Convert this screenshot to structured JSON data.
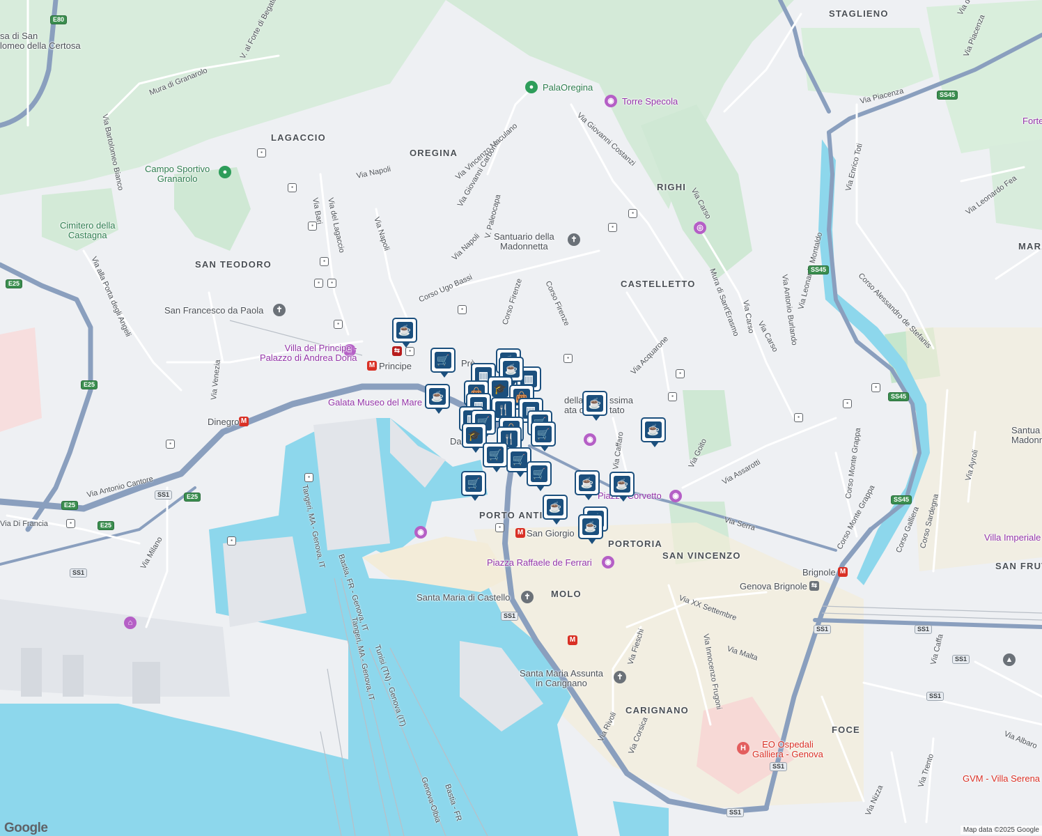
{
  "colors": {
    "water": "#8dd7ec",
    "land": "#eef0f3",
    "park": "#cdebd3",
    "highway": "#8a9fbe",
    "pin": "#1b4f7d"
  },
  "districts": [
    "LAGACCIO",
    "OREGINA",
    "RIGHI",
    "SAN TEODORO",
    "CASTELLETTO",
    "STAGLIENO",
    "PORTORIA",
    "SAN VINCENZO",
    "MOLO",
    "CARIGNANO",
    "FOCE",
    "SAN FRUT",
    "MARA",
    "PORTO ANTICO"
  ],
  "places": {
    "palaoregina": "PalaOregina",
    "torre_specola": "Torre Specola",
    "campo_sportivo": "Campo Sportivo\nGranarolo",
    "cimitero": "Cimitero della\nCastagna",
    "santuario": "Santuario della\nMadonnetta",
    "san_francesco": "San Francesco da Paola",
    "villa_principe": "Villa del Principe -\nPalazzo di Andrea Doria",
    "principe": "Principe",
    "galata": "Galata Museo del Mare",
    "dinegro": "Dinegro",
    "san_giorgio": "San Giorgio",
    "raffaele": "Piazza Raffaele de Ferrari",
    "corvetto": "Piazza Corvetto",
    "santa_maria_castello": "Santa Maria di Castello",
    "santa_maria_carignano": "Santa Maria Assunta\nin Carignano",
    "brignole_metro": "Brignole",
    "genova_brignole": "Genova Brignole",
    "galliera": "EO Ospedali\nGalliera - Genova",
    "gvm": "GVM - Villa Serena",
    "villa_imperiale": "Villa Imperiale",
    "santuario_madonna": "Santua\nMadonna de",
    "forte": "Forte",
    "certosa": "sa di San\nlomeo della Certosa",
    "annunziata": "della\nata del",
    "ssima": "ssima\ntato",
    "da": "Da",
    "pre": "Prè"
  },
  "streets": {
    "via_piacenza_1": "Via Piacenza",
    "via_piacenza_2": "Via Piacenza",
    "via_enrico_toti": "Via Enrico Toti",
    "via_leonardo_fea": "Via Leonardo Fea",
    "corso_de_stefanis": "Corso Alessandro de Stefanis",
    "via_montaldo": "Via Leonardo Montaldo",
    "via_burlando": "Via Antonio Burlando",
    "via_carso_1": "Via Carso",
    "via_carso_2": "Via Carso",
    "via_carso_3": "Via Carso",
    "mura_erasmo": "Mura di Sant'Erasmo",
    "via_costanzi": "Via Giovanni Costanzi",
    "via_maculano": "Via Vincenzo Maculano",
    "via_carbone": "Via Giovanni Carbone",
    "via_napoli_1": "Via Napoli",
    "via_napoli_2": "Via Napoli",
    "via_napoli_3": "Via Napoli",
    "v_paleocapa": "V. Paleocapa",
    "corso_bassi": "Corso Ugo Bassi",
    "corso_firenze_1": "Corso Firenze",
    "corso_firenze_2": "Corso Firenze",
    "via_acquarone": "Via Acquarone",
    "via_caffaro": "Via Caffaro",
    "via_goito": "Via Goito",
    "via_assarotti": "Via Assarotti",
    "via_serra": "Via Serra",
    "via_bari": "Via Bari",
    "via_lagaccio": "Via del Lagaccio",
    "mura_granarolo": "Mura di Granarolo",
    "v_forte_begato": "V. al Forte di Begato",
    "via_bologna_bianco": "Via Bartolomeo Bianco",
    "via_porta_angeli": "Via alla Porta degli Angeli",
    "via_venezia": "Via Venezia",
    "via_cantore": "Via Antonio Cantore",
    "via_di_francia": "Via Di Francia",
    "via_milano": "Via Milano",
    "tangeri_1": "Tangeri, MA - Genova, IT",
    "tangeri_2": "Tangeri, MA - Genova, IT",
    "bastia_1": "Bastia, FR - Genova, IT",
    "tunisi": "Tunisi (TN) - Genova (IT)",
    "genova_olbia": "Genova-Olbia",
    "bastia_2": "Bastia - FR",
    "via_xx": "Via XX Settembre",
    "via_malta": "Via Malta",
    "via_frugoni": "Via Innocenzo Frugoni",
    "via_fieschi": "Via Fieschi",
    "via_rivoli": "Via Rivoli",
    "via_corsica": "Via Corsica",
    "corso_monte_grappa_1": "Corso Monte Grappa",
    "corso_monte_grappa_2": "Corso Monte Grappa",
    "corso_galliera": "Corso Galliera",
    "corso_sardegna": "Corso Sardegna",
    "via_ayroli": "Via Ayroli",
    "via_caffa": "Via Caffa",
    "via_albaro": "Via Albaro",
    "via_trento": "Via Trento",
    "via_nizza": "Via Nizza",
    "via_de": "Via de"
  },
  "shields": [
    "E80",
    "E25",
    "E25",
    "E25",
    "E25",
    "SS1",
    "SS1",
    "SS1",
    "SS1",
    "SS1",
    "SS1",
    "SS1",
    "SS45",
    "SS45",
    "SS45",
    "SS45",
    "SS1",
    "SS1"
  ],
  "attribution": "Map data ©2025 Google",
  "logo": "Google"
}
